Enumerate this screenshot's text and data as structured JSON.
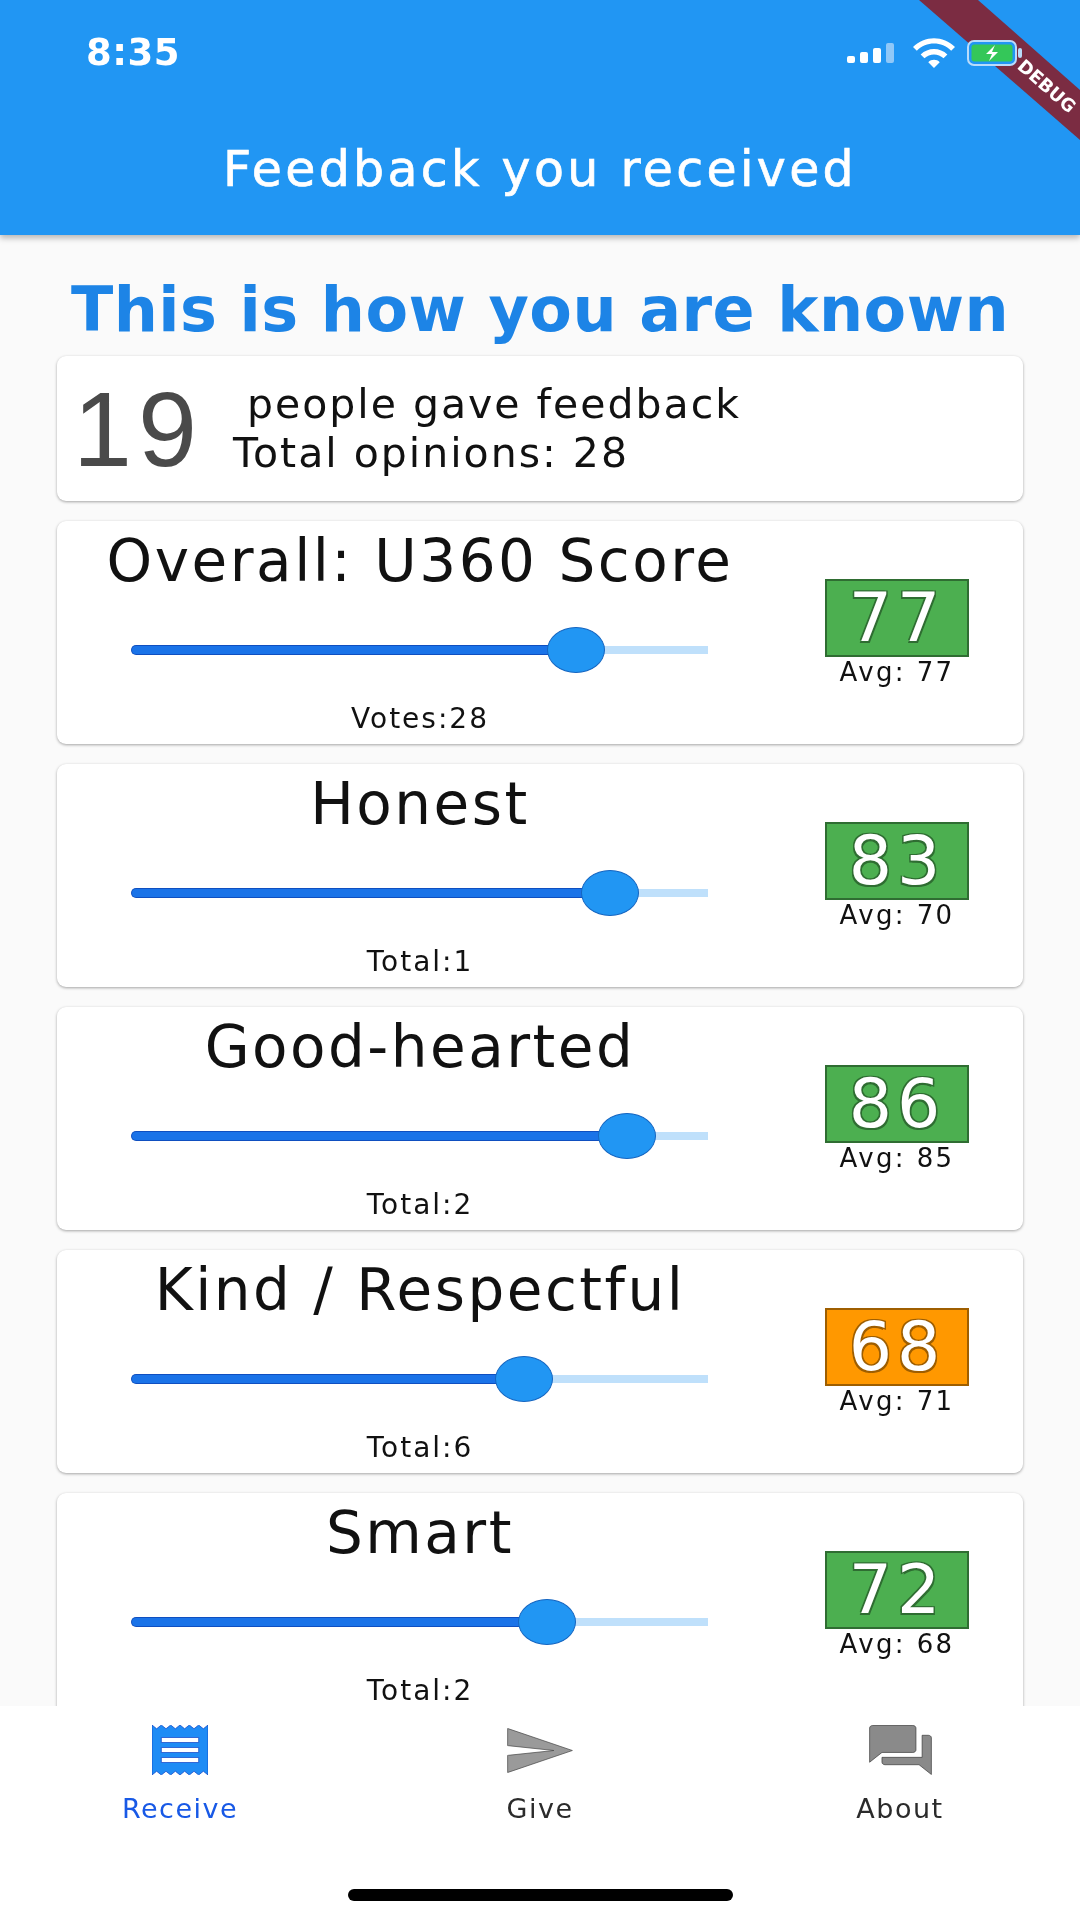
{
  "status_bar": {
    "time": "8:35"
  },
  "debug_banner": {
    "label": "DEBUG"
  },
  "app_bar": {
    "title": "Feedback you received"
  },
  "heading": "This is how you are known",
  "summary": {
    "count": "19",
    "people_label": "people gave feedback",
    "opinions_label": "Total opinions: 28"
  },
  "scores": [
    {
      "title": "Overall: U360 Score",
      "level": 0.77,
      "score": "77",
      "color": "#4caf50",
      "average": "Avg: 77",
      "tally": "Votes:28"
    },
    {
      "title": "Honest",
      "level": 0.83,
      "score": "83",
      "color": "#4caf50",
      "average": "Avg: 70",
      "tally": "Total:1"
    },
    {
      "title": "Good-hearted",
      "level": 0.86,
      "score": "86",
      "color": "#4caf50",
      "average": "Avg: 85",
      "tally": "Total:2"
    },
    {
      "title": "Kind / Respectful",
      "level": 0.68,
      "score": "68",
      "color": "#ff9800",
      "average": "Avg: 71",
      "tally": "Total:6"
    },
    {
      "title": "Smart",
      "level": 0.72,
      "score": "72",
      "color": "#4caf50",
      "average": "Avg: 68",
      "tally": "Total:2"
    }
  ],
  "nav": [
    {
      "label": "Receive",
      "selected": true
    },
    {
      "label": "Give",
      "selected": false
    },
    {
      "label": "About",
      "selected": false
    }
  ]
}
